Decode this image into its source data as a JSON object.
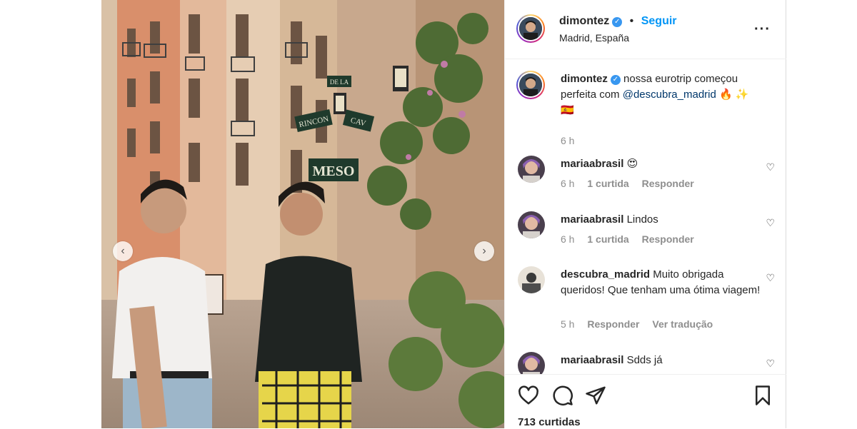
{
  "header": {
    "username": "dimontez",
    "follow_label": "Seguir",
    "location": "Madrid, España",
    "more_icon": "more-horizontal-icon"
  },
  "caption": {
    "username": "dimontez",
    "text_before": "nossa eurotrip começou perfeita com ",
    "mention": "@descubra_madrid",
    "emoji_line": "🔥 ✨🇪🇸",
    "time": "6 h"
  },
  "photo": {
    "signs": [
      "DE LA",
      "RINCON",
      "CAV",
      "MESO"
    ]
  },
  "comments": [
    {
      "username": "mariaabrasil",
      "text": "😍",
      "time": "6 h",
      "likes": "1 curtida",
      "reply": "Responder"
    },
    {
      "username": "mariaabrasil",
      "text": "Lindos",
      "time": "6 h",
      "likes": "1 curtida",
      "reply": "Responder"
    },
    {
      "username": "descubra_madrid",
      "text": "Muito obrigada queridos! Que tenham uma ótima viagem!",
      "time": "5 h",
      "reply": "Responder",
      "translate": "Ver tradução"
    },
    {
      "username": "mariaabrasil",
      "text": "Sdds já"
    }
  ],
  "footer": {
    "likes": "713 curtidas"
  },
  "colors": {
    "accent": "#0095f6",
    "verified": "#3897f0",
    "mention": "#00376b",
    "muted": "#8e8e8e"
  }
}
